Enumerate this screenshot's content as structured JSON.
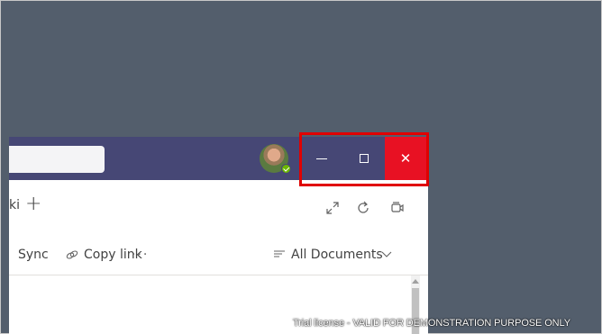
{
  "tabs": {
    "partial_tab_label": "ki",
    "add_tab_symbol": "+"
  },
  "command_bar": {
    "sync_label": "Sync",
    "copy_link_label": "Copy link",
    "more_label": "···",
    "view_label": "All Documents"
  },
  "window_controls": {
    "close_symbol": "✕"
  },
  "icons": {
    "expand": "expand-icon",
    "refresh": "refresh-icon",
    "meet": "meet-now-icon",
    "copy_link": "link-icon",
    "view": "view-list-icon",
    "chevron": "chevron-down-icon"
  },
  "colors": {
    "title_bar": "#464775",
    "close_button": "#e81123",
    "desktop": "#535e6c",
    "highlight_box": "#e00000",
    "presence_available": "#6bb700"
  },
  "watermark": "Trial license - VALID FOR DEMONSTRATION PURPOSE ONLY"
}
